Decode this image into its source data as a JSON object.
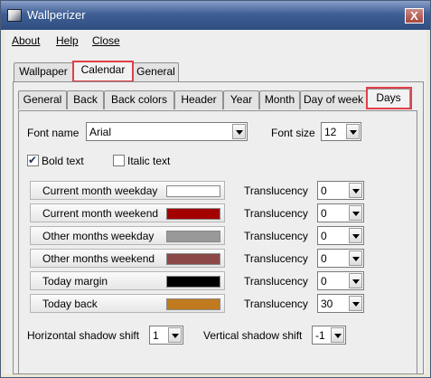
{
  "window": {
    "title": "Wallperizer",
    "close_glyph": "X"
  },
  "menu": {
    "about": "About",
    "help": "Help",
    "close": "Close"
  },
  "main_tabs": [
    "Wallpaper",
    "Calendar",
    "General"
  ],
  "sub_tabs": [
    "General",
    "Back",
    "Back colors",
    "Header",
    "Year",
    "Month",
    "Day of week",
    "Days"
  ],
  "font": {
    "name_label": "Font name",
    "name_value": "Arial",
    "size_label": "Font size",
    "size_value": "12"
  },
  "style": {
    "bold_label": "Bold text",
    "bold_checked": true,
    "italic_label": "Italic text",
    "italic_checked": false,
    "check_glyph": "✔"
  },
  "translucency_label": "Translucency",
  "color_rows": [
    {
      "label": "Current month weekday",
      "color": "#ffffff",
      "translucency": "0"
    },
    {
      "label": "Current month weekend",
      "color": "#a30000",
      "translucency": "0"
    },
    {
      "label": "Other months weekday",
      "color": "#999999",
      "translucency": "0"
    },
    {
      "label": "Other months weekend",
      "color": "#8c4747",
      "translucency": "0"
    },
    {
      "label": "Today margin",
      "color": "#000000",
      "translucency": "0"
    },
    {
      "label": "Today back",
      "color": "#c17a1e",
      "translucency": "30"
    }
  ],
  "shadow": {
    "h_label": "Horizontal shadow shift",
    "h_value": "1",
    "v_label": "Vertical shadow shift",
    "v_value": "-1"
  }
}
